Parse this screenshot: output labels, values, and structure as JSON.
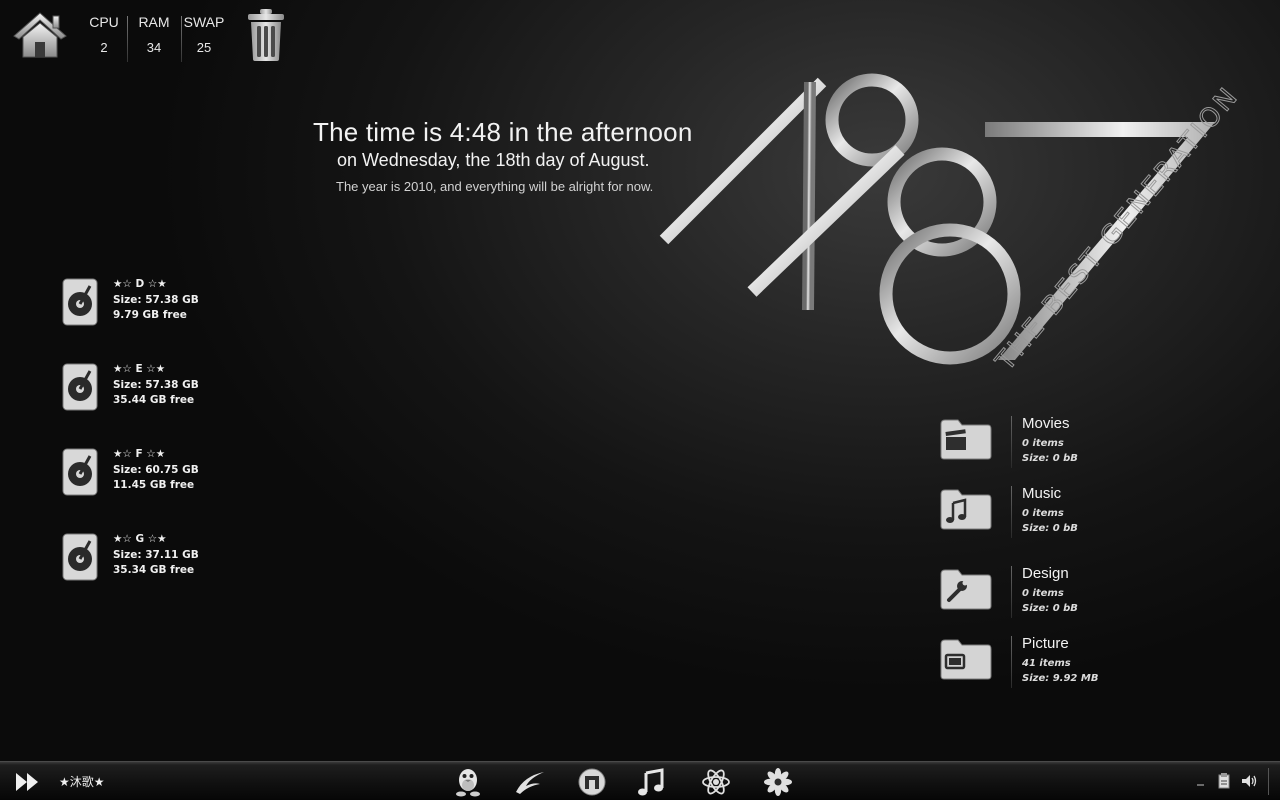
{
  "system": {
    "cpu": {
      "label": "CPU",
      "value": "2"
    },
    "ram": {
      "label": "RAM",
      "value": "34"
    },
    "swap": {
      "label": "SWAP",
      "value": "25"
    }
  },
  "clock": {
    "line1": "The time is 4:48 in the afternoon",
    "line2": "on Wednesday, the 18th day of August.",
    "line3": "The year is 2010, and everything will be alright for now."
  },
  "logo": {
    "digits": "1987",
    "tagline": "THE BEST GENERATION"
  },
  "drives": [
    {
      "name": "★☆ D ☆★",
      "size": "Size: 57.38 GB",
      "free": "9.79 GB free"
    },
    {
      "name": "★☆ E ☆★",
      "size": "Size: 57.38 GB",
      "free": "35.44 GB free"
    },
    {
      "name": "★☆ F ☆★",
      "size": "Size: 60.75 GB",
      "free": "11.45 GB free"
    },
    {
      "name": "★☆ G ☆★",
      "size": "Size: 37.11 GB",
      "free": "35.34 GB free"
    }
  ],
  "folders": [
    {
      "name": "Movies",
      "items": "0 items",
      "size": "Size: 0 bB",
      "icon": "clapperboard-icon"
    },
    {
      "name": "Music",
      "items": "0 items",
      "size": "Size: 0 bB",
      "icon": "music-note-icon"
    },
    {
      "name": "Design",
      "items": "0 items",
      "size": "Size: 0 bB",
      "icon": "wrench-icon"
    },
    {
      "name": "Picture",
      "items": "41 items",
      "size": "Size: 9.92 MB",
      "icon": "screen-icon"
    }
  ],
  "taskbar": {
    "user_label": "★沐歌★",
    "apps": [
      "qq-penguin-icon",
      "swift-bird-icon",
      "maxthon-browser-icon",
      "music-player-icon",
      "atom-icon",
      "flower-icon"
    ]
  },
  "colors": {
    "background": "#141414",
    "text": "#f0f0f0",
    "taskbar": "#111111"
  }
}
